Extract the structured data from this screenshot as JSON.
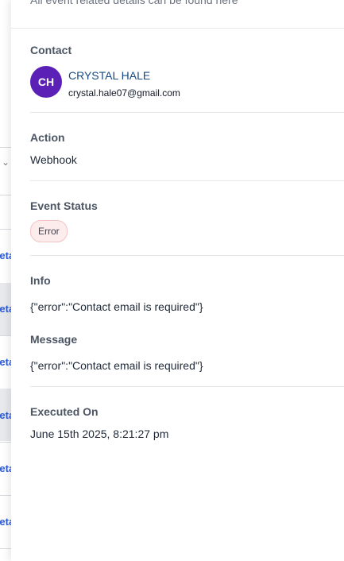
{
  "background": {
    "row_link_label": "Details"
  },
  "drawer": {
    "subtitle": "All event related details can be found here",
    "contact": {
      "label": "Contact",
      "initials": "CH",
      "name": "CRYSTAL HALE",
      "email": "crystal.hale07@gmail.com",
      "avatar_color": "#5b21b6"
    },
    "action": {
      "label": "Action",
      "value": "Webhook"
    },
    "event_status": {
      "label": "Event Status",
      "value": "Error",
      "badge_color": "#fdecec"
    },
    "info": {
      "label": "Info",
      "value": "{\"error\":\"Contact email is required\"}"
    },
    "message": {
      "label": "Message",
      "value": "{\"error\":\"Contact email is required\"}"
    },
    "executed_on": {
      "label": "Executed On",
      "value": "June 15th 2025, 8:21:27 pm"
    }
  }
}
